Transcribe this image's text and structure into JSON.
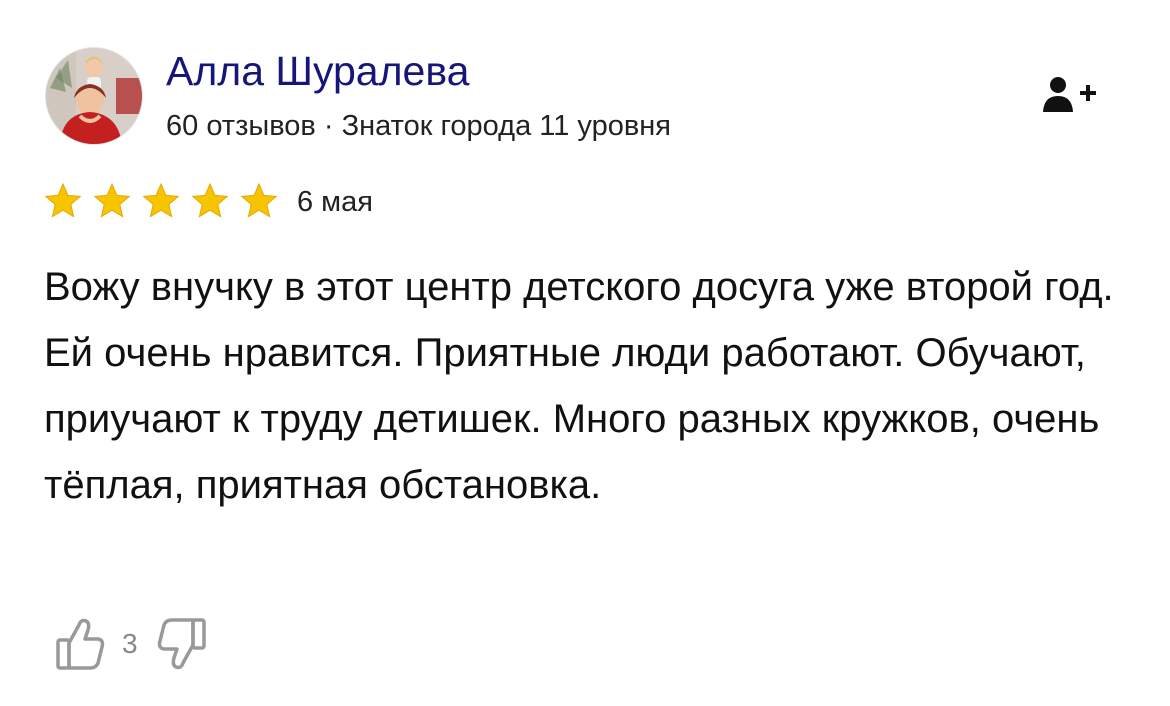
{
  "author": {
    "name": "Алла Шуралева",
    "meta": "60 отзывов · Знаток города 11 уровня",
    "subscribe_icon": "add-user-icon"
  },
  "review": {
    "rating": 5,
    "rating_max": 5,
    "date": "6 мая",
    "text": "Вожу внучку в этот центр детского досуга уже второй год. Ей очень нравится. Приятные люди работают. Обучают, приучают к труду детишек. Много разных кружков, очень тёплая, приятная обстановка."
  },
  "reactions": {
    "like_icon": "thumbs-up-icon",
    "likes": "3",
    "dislike_icon": "thumbs-down-icon"
  },
  "colors": {
    "name": "#15157a",
    "star": "#f7c400",
    "star_stroke": "#e5a800",
    "icon_gray": "#999999"
  }
}
